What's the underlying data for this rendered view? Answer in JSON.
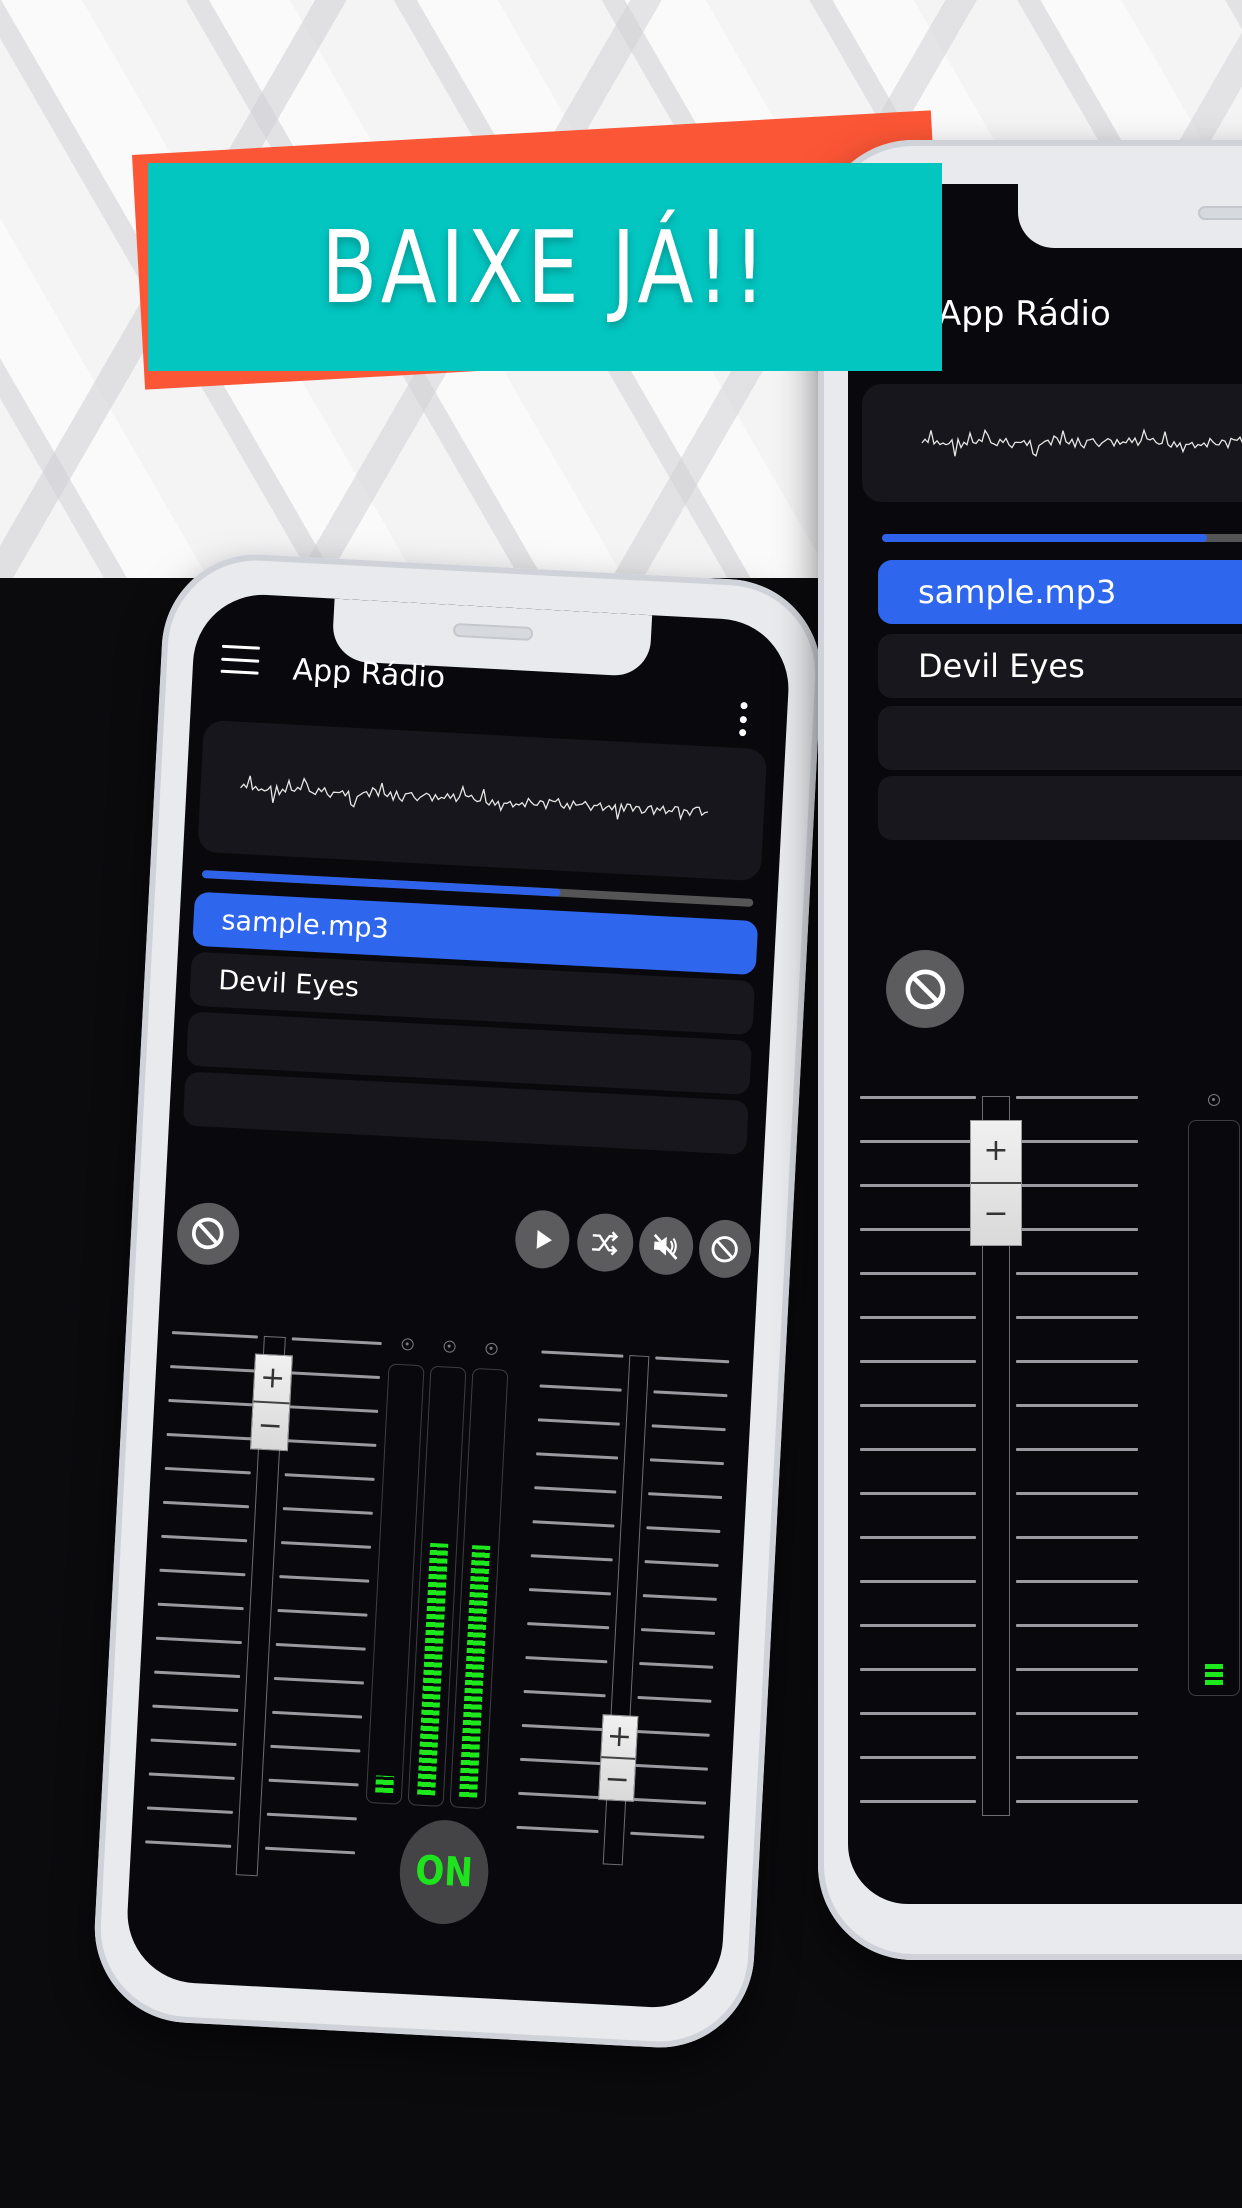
{
  "banner": {
    "text": "BAIXE JÁ!!",
    "colors": {
      "front": "#03c6c1",
      "back": "#fb5635",
      "text": "#ffffff"
    }
  },
  "app": {
    "title": "App Rádio",
    "icons": {
      "menu": "hamburger-menu-icon",
      "overflow": "more-vert-icon"
    }
  },
  "player": {
    "progress_fraction": 0.65,
    "tracks": [
      {
        "name": "sample.mp3",
        "active": true
      },
      {
        "name": "Devil Eyes",
        "active": false
      },
      {
        "name": "",
        "active": false
      },
      {
        "name": "",
        "active": false
      }
    ],
    "controls": [
      {
        "name": "play",
        "icon": "play-icon"
      },
      {
        "name": "shuffle",
        "icon": "shuffle-icon"
      },
      {
        "name": "mute",
        "icon": "volume-off-icon"
      },
      {
        "name": "block",
        "icon": "block-icon"
      }
    ],
    "left_block_icon": "block-icon"
  },
  "mixer": {
    "fader_left": {
      "plus": "+",
      "minus": "−",
      "level": 0.96
    },
    "fader_right": {
      "plus": "+",
      "minus": "−",
      "level": 0.15
    },
    "meters": [
      {
        "level": 0.04
      },
      {
        "level": 0.6
      },
      {
        "level": 0.6
      }
    ],
    "power_label": "ON",
    "colors": {
      "meter": "#1ce81c",
      "accent": "#2f66ee"
    }
  }
}
